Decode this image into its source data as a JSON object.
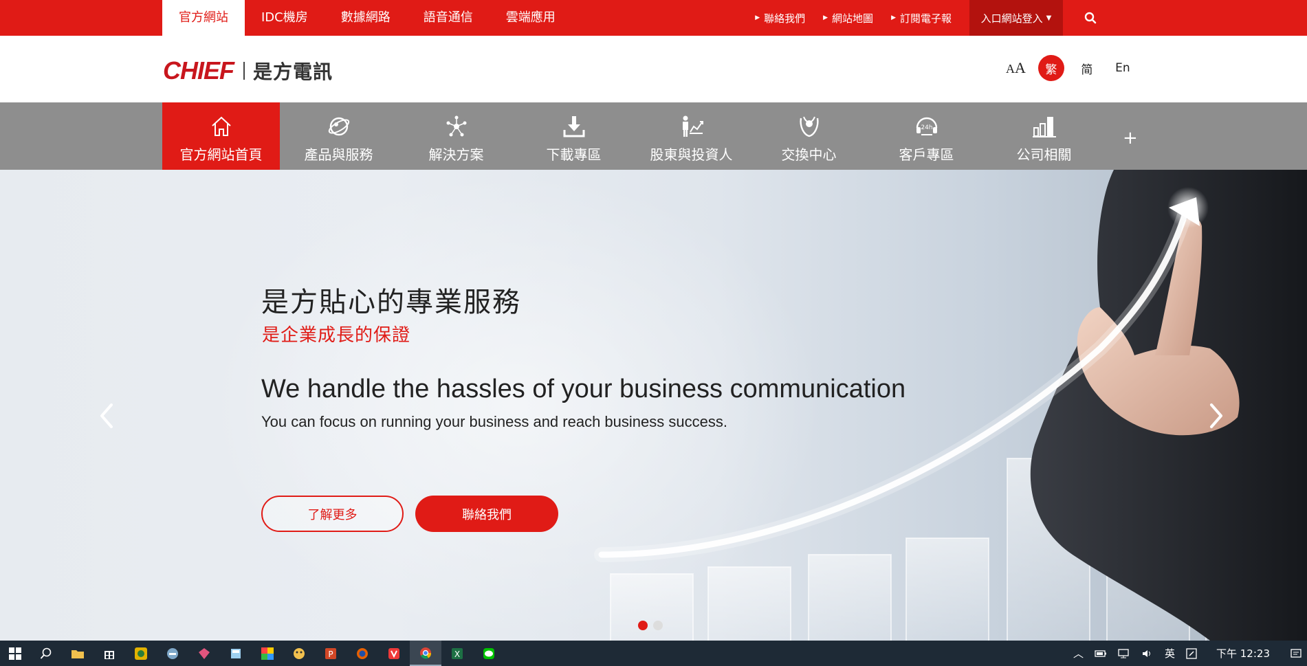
{
  "topbar": {
    "tabs": [
      {
        "label": "官方網站"
      },
      {
        "label": "IDC機房"
      },
      {
        "label": "數據網路"
      },
      {
        "label": "語音通信"
      },
      {
        "label": "雲端應用"
      }
    ],
    "links": [
      {
        "label": "聯絡我們"
      },
      {
        "label": "網站地圖"
      },
      {
        "label": "訂閱電子報"
      }
    ],
    "login_label": "入口網站登入",
    "search_icon": "search-icon"
  },
  "logo": {
    "brand": "CHIEF",
    "company": "是方電訊"
  },
  "language": {
    "fontsize_label_small": "A",
    "fontsize_label_large": "A",
    "options": [
      {
        "label": "繁"
      },
      {
        "label": "简"
      },
      {
        "label": "En"
      }
    ]
  },
  "mainnav": {
    "items": [
      {
        "label": "官方網站首頁",
        "icon": "home-icon"
      },
      {
        "label": "產品與服務",
        "icon": "globe-icon"
      },
      {
        "label": "解決方案",
        "icon": "network-icon"
      },
      {
        "label": "下載專區",
        "icon": "download-icon"
      },
      {
        "label": "股東與投資人",
        "icon": "investor-icon"
      },
      {
        "label": "交換中心",
        "icon": "exchange-icon"
      },
      {
        "label": "客戶專區",
        "icon": "support-24h-icon"
      },
      {
        "label": "公司相關",
        "icon": "company-icon"
      }
    ],
    "more_label": "+"
  },
  "hero": {
    "title": "是方貼心的專業服務",
    "subtitle": "是企業成長的保證",
    "headline_en": "We handle the hassles of your business communication",
    "subline_en": "You can focus on running your business and reach business success.",
    "btn_more": "了解更多",
    "btn_contact": "聯絡我們",
    "slide_count": 2,
    "active_slide": 1
  },
  "taskbar": {
    "ime": "英",
    "clock": "下午 12:23"
  },
  "colors": {
    "brand_red": "#e01b16",
    "nav_gray": "#8e8e8e",
    "login_dark_red": "#b3120e"
  }
}
